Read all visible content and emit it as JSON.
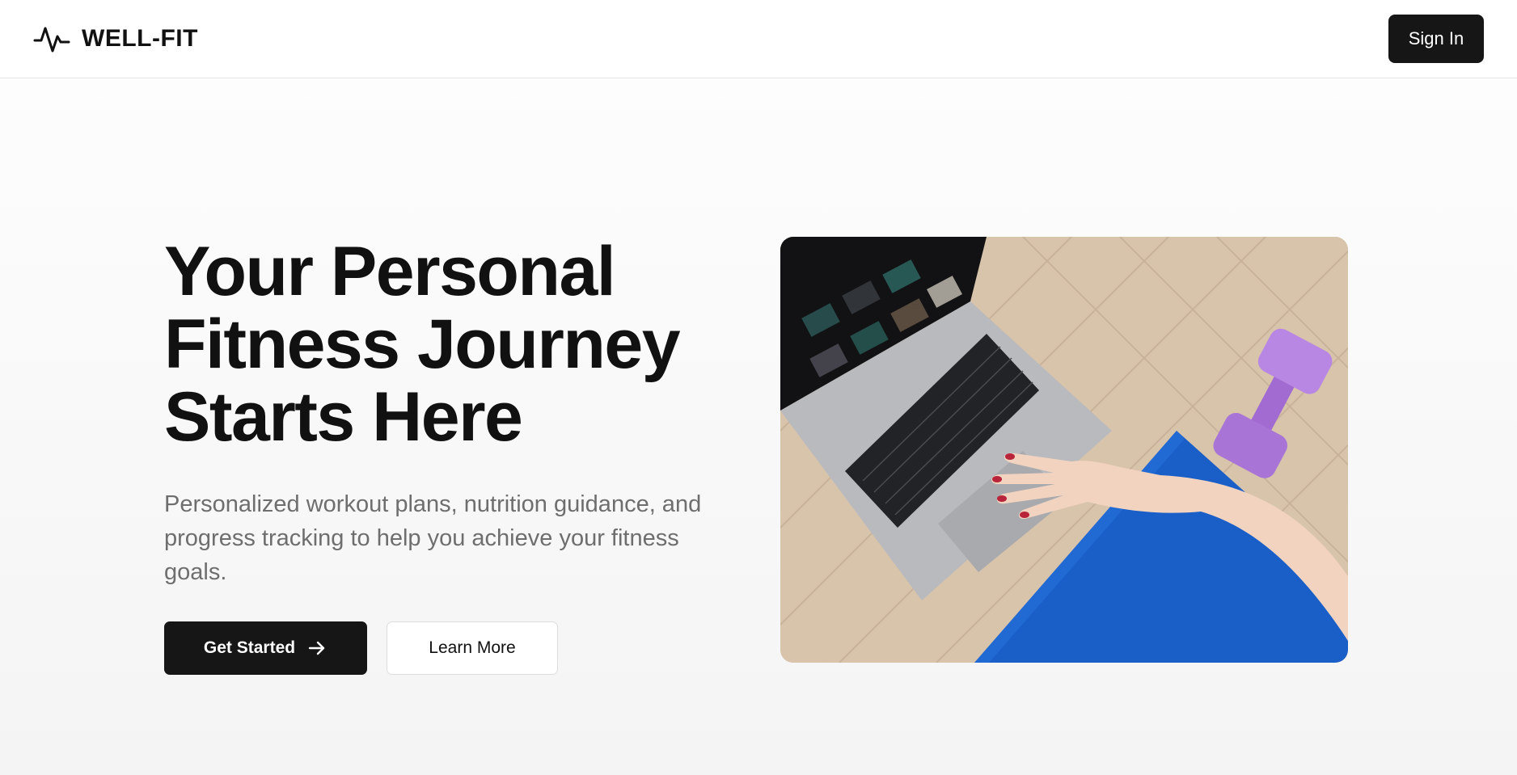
{
  "header": {
    "brand_icon": "pulse-icon",
    "brand_name": "WELL-FIT",
    "signin_label": "Sign In"
  },
  "hero": {
    "title_lines": [
      "Your Personal",
      "Fitness Journey",
      "Starts Here"
    ],
    "subtitle": "Personalized workout plans, nutrition guidance, and progress tracking to help you achieve your fitness goals.",
    "primary_button": {
      "label": "Get Started",
      "icon": "arrow-right-icon"
    },
    "secondary_button": {
      "label": "Learn More"
    },
    "image_subject": "hero-photo"
  },
  "colors": {
    "primary_dark": "#161616",
    "text_muted": "#6e6e6e",
    "background": "#f7f7f7"
  }
}
